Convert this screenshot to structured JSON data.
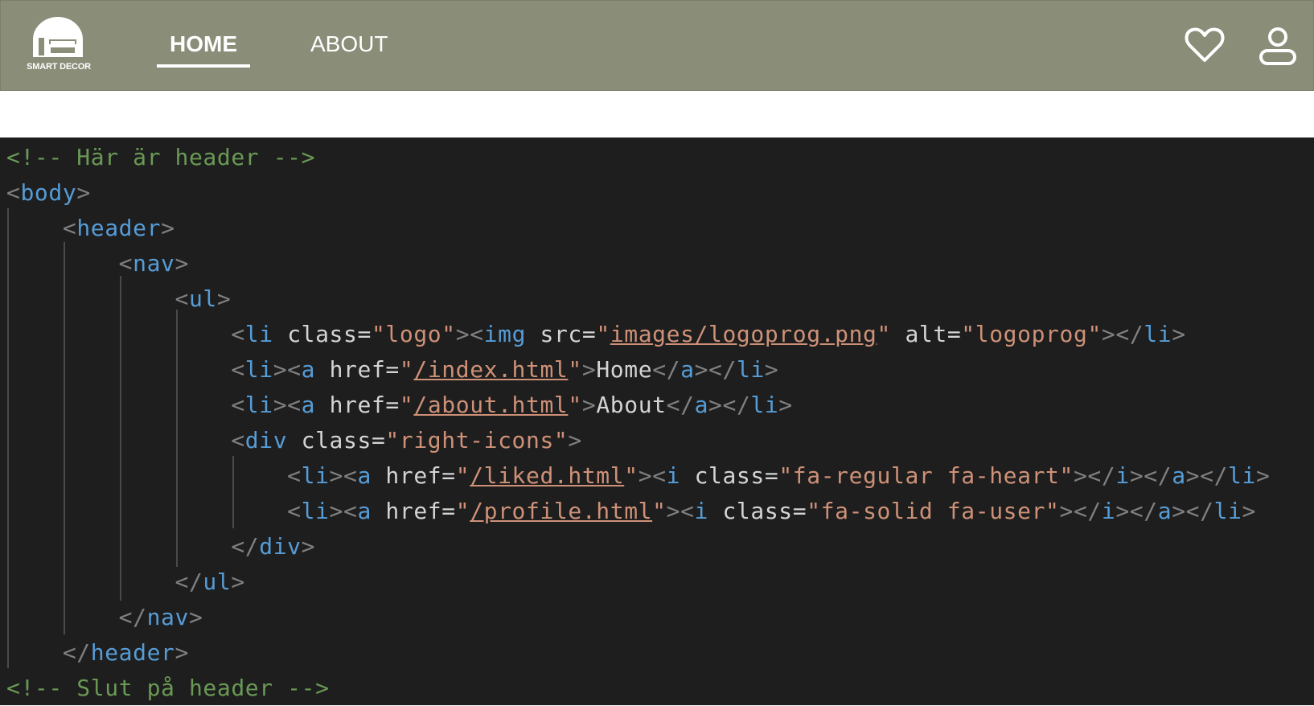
{
  "header": {
    "logo_text": "SMART DECOR",
    "nav": [
      {
        "label": "HOME",
        "active": true
      },
      {
        "label": "ABOUT",
        "active": false
      }
    ],
    "icons": [
      "heart-icon",
      "user-icon"
    ],
    "background_color": "#8a8d78"
  },
  "code": {
    "comment_start": "<!-- Här är header -->",
    "body": "body",
    "header": "header",
    "nav": "nav",
    "ul": "ul",
    "li": "li",
    "a": "a",
    "img": "img",
    "div": "div",
    "i": "i",
    "attr_class": "class",
    "attr_src": "src",
    "attr_alt": "alt",
    "attr_href": "href",
    "logo_class": "logo",
    "logo_src": "images/logoprog.png",
    "logo_alt": "logoprog",
    "home_href": "/index.html",
    "home_text": "Home",
    "about_href": "/about.html",
    "about_text": "About",
    "right_icons_class": "right-icons",
    "liked_href": "/liked.html",
    "heart_class": "fa-regular fa-heart",
    "profile_href": "/profile.html",
    "user_class": "fa-solid fa-user",
    "comment_end": "<!-- Slut på header -->"
  }
}
